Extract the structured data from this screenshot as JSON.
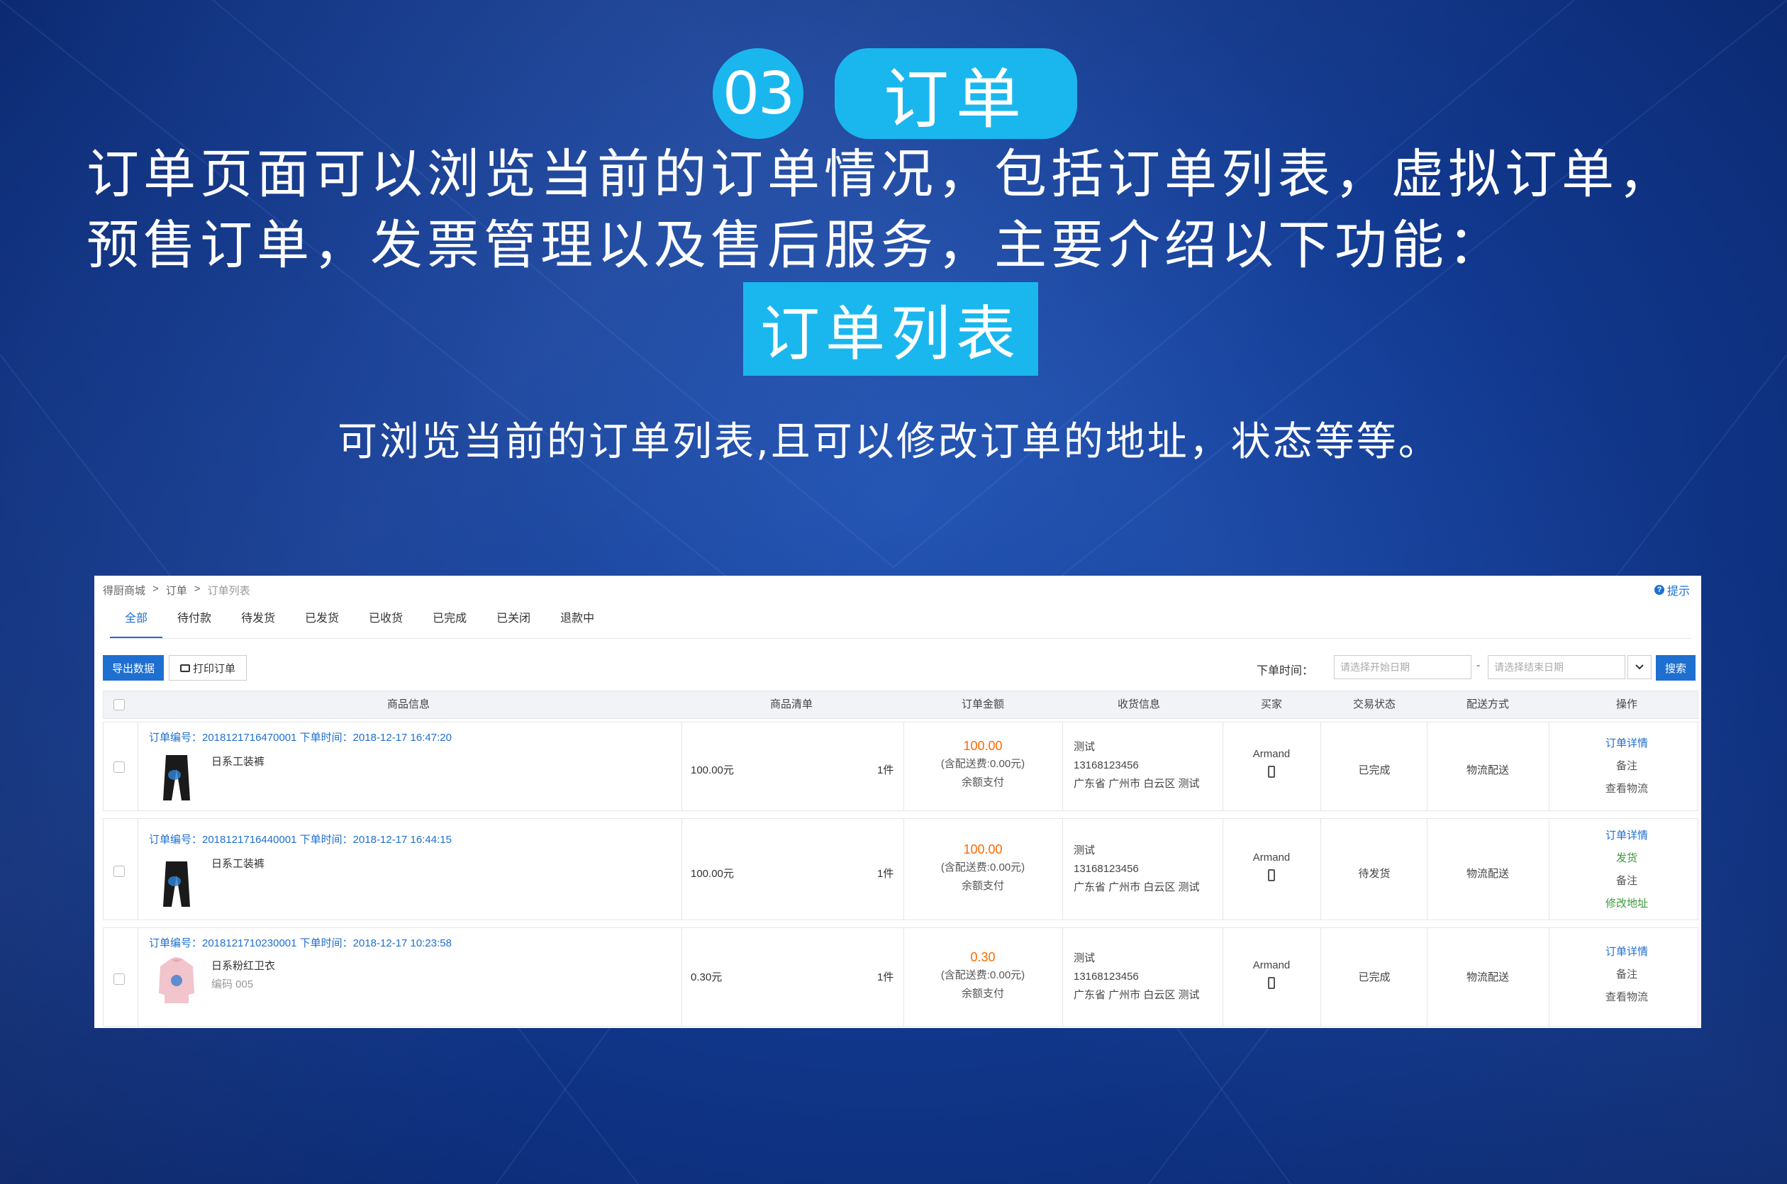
{
  "hero": {
    "number": "03",
    "title": "订单",
    "intro": "订单页面可以浏览当前的订单情况，包括订单列表，虚拟订单，预售订单，发票管理以及售后服务，主要介绍以下功能：",
    "section": "订单列表",
    "description": "可浏览当前的订单列表,且可以修改订单的地址，状态等等。"
  },
  "ui": {
    "breadcrumb": [
      "得厨商城",
      "订单",
      "订单列表"
    ],
    "breadcrumb_sep": ">",
    "tip": "提示",
    "tabs": [
      "全部",
      "待付款",
      "待发货",
      "已发货",
      "已收货",
      "已完成",
      "已关闭",
      "退款中"
    ],
    "active_tab": 0,
    "toolbar": {
      "export": "导出数据",
      "print": "打印订单",
      "date_label": "下单时间：",
      "start_placeholder": "请选择开始日期",
      "dash": "-",
      "end_placeholder": "请选择结束日期",
      "search": "搜索"
    },
    "columns": [
      "商品信息",
      "商品清单",
      "订单金额",
      "收货信息",
      "买家",
      "交易状态",
      "配送方式",
      "操作"
    ],
    "orders": [
      {
        "header": "订单编号：2018121716470001 下单时间：2018-12-17 16:47:20",
        "product": "日系工装裤",
        "code": "",
        "thumb": "pants",
        "price": "100.00元",
        "qty": "1件",
        "amount": "100.00",
        "shipping_fee": "(含配送费:0.00元)",
        "pay": "余额支付",
        "recv_name": "测试",
        "recv_phone": "13168123456",
        "recv_addr": "广东省 广州市 白云区 测试",
        "buyer": "Armand",
        "status": "已完成",
        "ship": "物流配送",
        "ops": [
          {
            "label": "订单详情",
            "style": "link"
          },
          {
            "label": "备注",
            "style": "grey"
          },
          {
            "label": "查看物流",
            "style": "grey"
          }
        ]
      },
      {
        "header": "订单编号：2018121716440001 下单时间：2018-12-17 16:44:15",
        "product": "日系工装裤",
        "code": "",
        "thumb": "pants",
        "price": "100.00元",
        "qty": "1件",
        "amount": "100.00",
        "shipping_fee": "(含配送费:0.00元)",
        "pay": "余额支付",
        "recv_name": "测试",
        "recv_phone": "13168123456",
        "recv_addr": "广东省 广州市 白云区 测试",
        "buyer": "Armand",
        "status": "待发货",
        "ship": "物流配送",
        "ops": [
          {
            "label": "订单详情",
            "style": "link"
          },
          {
            "label": "发货",
            "style": "green"
          },
          {
            "label": "备注",
            "style": "grey"
          },
          {
            "label": "修改地址",
            "style": "green"
          }
        ]
      },
      {
        "header": "订单编号：2018121710230001 下单时间：2018-12-17 10:23:58",
        "product": "日系粉红卫衣",
        "code": "编码  005",
        "thumb": "hoodie",
        "price": "0.30元",
        "qty": "1件",
        "amount": "0.30",
        "shipping_fee": "(含配送费:0.00元)",
        "pay": "余额支付",
        "recv_name": "测试",
        "recv_phone": "13168123456",
        "recv_addr": "广东省 广州市 白云区 测试",
        "buyer": "Armand",
        "status": "已完成",
        "ship": "物流配送",
        "ops": [
          {
            "label": "订单详情",
            "style": "link"
          },
          {
            "label": "备注",
            "style": "grey"
          },
          {
            "label": "查看物流",
            "style": "grey"
          }
        ]
      }
    ]
  },
  "colors": {
    "accent": "#1ab7ee",
    "ui_blue": "#1e6fd0",
    "amount_orange": "#ff6a00",
    "op_green": "#3a9a3a"
  }
}
